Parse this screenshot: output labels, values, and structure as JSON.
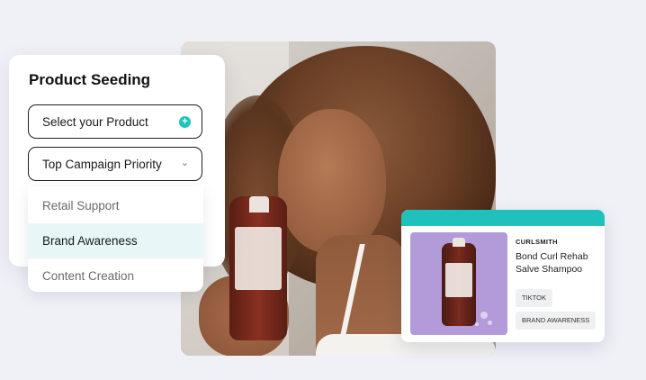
{
  "panel": {
    "title": "Product Seeding",
    "select_product": "Select your Product",
    "campaign_priority": "Top Campaign Priority"
  },
  "dropdown": {
    "options": [
      "Retail Support",
      "Brand Awareness",
      "Content Creation"
    ],
    "highlighted": "Brand Awareness"
  },
  "product_card": {
    "brand": "CURLSMITH",
    "name": "Bond Curl Rehab Salve Shampoo",
    "tags": [
      "TIKTOK",
      "BRAND AWARENESS"
    ],
    "accent_color": "#20c0bc"
  },
  "icons": {
    "plus": "plus-circle-icon",
    "chevron": "chevron-down-icon"
  }
}
